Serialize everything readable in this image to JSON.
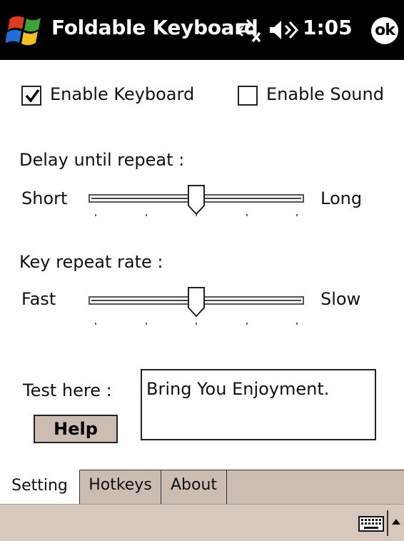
{
  "titlebar": {
    "title": "Foldable Keyboard",
    "clock": "1:05",
    "ok_label": "ok",
    "icons": [
      "windows-start-icon",
      "connectivity-icon",
      "volume-icon"
    ],
    "background": "#000000"
  },
  "settings": {
    "enable_keyboard": {
      "label": "Enable Keyboard",
      "checked": true
    },
    "enable_sound": {
      "label": "Enable Sound",
      "checked": false
    }
  },
  "delay": {
    "label": "Delay until repeat :",
    "min_label": "Short",
    "max_label": "Long",
    "level": 0.5
  },
  "rate": {
    "label": "Key repeat rate :",
    "min_label": "Fast",
    "max_label": "Slow",
    "level": 0.5
  },
  "test": {
    "label": "Test here :",
    "value": "Bring You Enjoyment.",
    "help_label": "Help"
  },
  "tabs": [
    {
      "label": "Setting",
      "active": true
    },
    {
      "label": "Hotkeys",
      "active": false
    },
    {
      "label": "About",
      "active": false
    }
  ],
  "menubar": {
    "icons": [
      "keyboard-icon",
      "arrow-up-icon"
    ],
    "background": "#d6c8bd"
  }
}
